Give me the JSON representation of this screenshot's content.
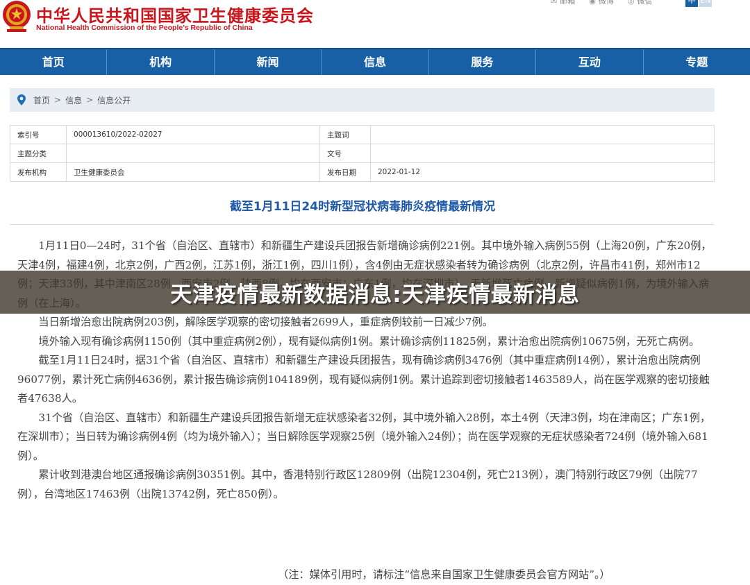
{
  "header": {
    "site_name_cn": "中华人民共和国国家卫生健康委员会",
    "site_name_en": "National Health Commission of the People’s Republic of China",
    "share_links": [
      {
        "label": "邮箱",
        "icon": "mail-icon"
      },
      {
        "label": "微博",
        "icon": "weibo-icon"
      },
      {
        "label": "微信",
        "icon": "wechat-icon"
      }
    ],
    "lang_cn": "中",
    "lang_en": "EN"
  },
  "nav": {
    "items": [
      "首页",
      "机构",
      "新闻",
      "信息",
      "服务",
      "互动",
      "专题"
    ]
  },
  "breadcrumb": {
    "items": [
      "首页",
      "信息",
      "信息公开"
    ],
    "separator": ">"
  },
  "meta": {
    "index_label": "索引号",
    "index_value": "000013610/2022-02027",
    "keywords_label": "主题词",
    "keywords_value": "",
    "category_label": "主题分类",
    "category_value": "",
    "doc_no_label": "文号",
    "doc_no_value": "",
    "publisher_label": "发布机构",
    "publisher_value": "卫生健康委员会",
    "date_label": "发布日期",
    "date_value": "2022-01-12"
  },
  "article": {
    "title": "截至1月11日24时新型冠状病毒肺炎疫情最新情况",
    "paragraphs": [
      "1月11日0—24时，31个省（自治区、直辖市）和新疆生产建设兵团报告新增确诊病例221例。其中境外输入病例55例（上海20例，广东20例，天津4例，福建4例，北京2例，广西2例，江苏1例，浙江1例，四川1例），含4例由无症状感染者转为确诊病例（北京2例，许昌市41例，郑州市12例；天津33例，其中津南区28例，西安市2例，陕西8例，均在西安市；广东1例，均在深圳市）。无新增死亡病例。新增疑似病例1例，为境外输入病例（在上海）。",
      "当日新增治愈出院病例203例，解除医学观察的密切接触者2699人，重症病例较前一日减少7例。",
      "境外输入现有确诊病例1150例（其中重症病例2例），现有疑似病例1例。累计确诊病例11825例，累计治愈出院病例10675例，无死亡病例。",
      "截至1月11日24时，据31个省（自治区、直辖市）和新疆生产建设兵团报告，现有确诊病例3476例（其中重症病例14例），累计治愈出院病例96077例，累计死亡病例4636例，累计报告确诊病例104189例，现有疑似病例1例。累计追踪到密切接触者1463589人，尚在医学观察的密切接触者47638人。",
      "31个省（自治区、直辖市）和新疆生产建设兵团报告新增无症状感染者32例，其中境外输入28例，本土4例（天津3例，均在津南区；广东1例，在深圳市）；当日转为确诊病例4例（均为境外输入）；当日解除医学观察25例（境外输入24例）；尚在医学观察的无症状感染者724例（境外输入681例）。",
      "累计收到港澳台地区通报确诊病例30351例。其中，香港特别行政区12809例（出院12304例，死亡213例），澳门特别行政区79例（出院77例），台湾地区17463例（出院13742例，死亡850例）。"
    ],
    "note": "（注：媒体引用时，请标注“信息来自国家卫生健康委员会官方网站”。）"
  },
  "banner": {
    "text": "天津疫情最新数据消息:天津疾情最新消息"
  },
  "colors": {
    "brand_red": "#c8161d",
    "nav_blue": "#1760a6",
    "title_blue": "#1f5aa7"
  }
}
